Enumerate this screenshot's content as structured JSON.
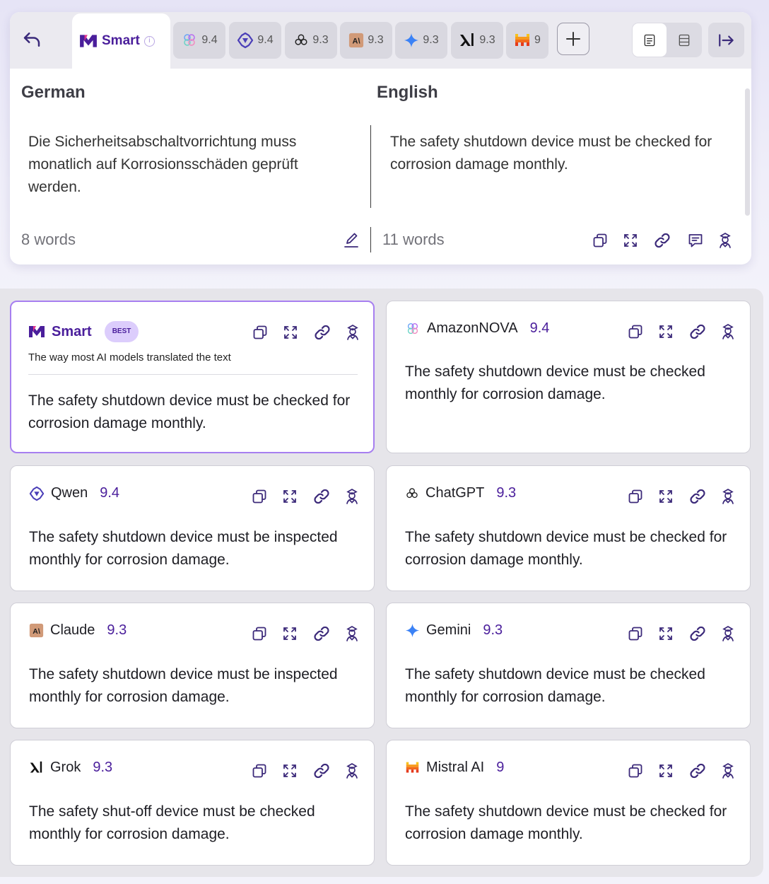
{
  "tabs": {
    "smart_label": "Smart",
    "models": [
      {
        "name": "AmazonNOVA",
        "icon": "amazon-nova-icon",
        "score": "9.4"
      },
      {
        "name": "Qwen",
        "icon": "qwen-icon",
        "score": "9.4"
      },
      {
        "name": "ChatGPT",
        "icon": "chatgpt-icon",
        "score": "9.3"
      },
      {
        "name": "Claude",
        "icon": "claude-icon",
        "score": "9.3"
      },
      {
        "name": "Gemini",
        "icon": "gemini-icon",
        "score": "9.3"
      },
      {
        "name": "Grok",
        "icon": "grok-icon",
        "score": "9.3"
      },
      {
        "name": "Mistral AI",
        "icon": "mistral-icon",
        "score": "9"
      }
    ]
  },
  "source": {
    "language": "German",
    "text": "Die Sicherheitsabschaltvorrichtung muss monatlich auf Korrosionsschäden geprüft werden.",
    "word_count": "8 words"
  },
  "target": {
    "language": "English",
    "text": "The safety shutdown device must be checked for corrosion damage monthly.",
    "word_count": "11 words"
  },
  "results": [
    {
      "name": "Smart",
      "icon": "smart-icon",
      "score": "",
      "badge": "BEST",
      "subtitle": "The way most AI models translated the text",
      "text": "The safety shutdown device must be checked for corrosion damage monthly."
    },
    {
      "name": "AmazonNOVA",
      "icon": "amazon-nova-icon",
      "score": "9.4",
      "badge": "",
      "subtitle": "",
      "text": "The safety shutdown device must be checked monthly for corrosion damage."
    },
    {
      "name": "Qwen",
      "icon": "qwen-icon",
      "score": "9.4",
      "badge": "",
      "subtitle": "",
      "text": "The safety shutdown device must be inspected monthly for corrosion damage."
    },
    {
      "name": "ChatGPT",
      "icon": "chatgpt-icon",
      "score": "9.3",
      "badge": "",
      "subtitle": "",
      "text": "The safety shutdown device must be checked for corrosion damage monthly."
    },
    {
      "name": "Claude",
      "icon": "claude-icon",
      "score": "9.3",
      "badge": "",
      "subtitle": "",
      "text": "The safety shutdown device must be inspected monthly for corrosion damage."
    },
    {
      "name": "Gemini",
      "icon": "gemini-icon",
      "score": "9.3",
      "badge": "",
      "subtitle": "",
      "text": "The safety shutdown device must be checked monthly for corrosion damage."
    },
    {
      "name": "Grok",
      "icon": "grok-icon",
      "score": "9.3",
      "badge": "",
      "subtitle": "",
      "text": "The safety shut-off device must be checked monthly for corrosion damage."
    },
    {
      "name": "Mistral AI",
      "icon": "mistral-icon",
      "score": "9",
      "badge": "",
      "subtitle": "",
      "text": "The safety shutdown device must be checked for corrosion damage monthly."
    }
  ],
  "colors": {
    "accent": "#4a1e9b",
    "best_border": "#a77ff0",
    "badge_bg": "#dccdfc"
  }
}
